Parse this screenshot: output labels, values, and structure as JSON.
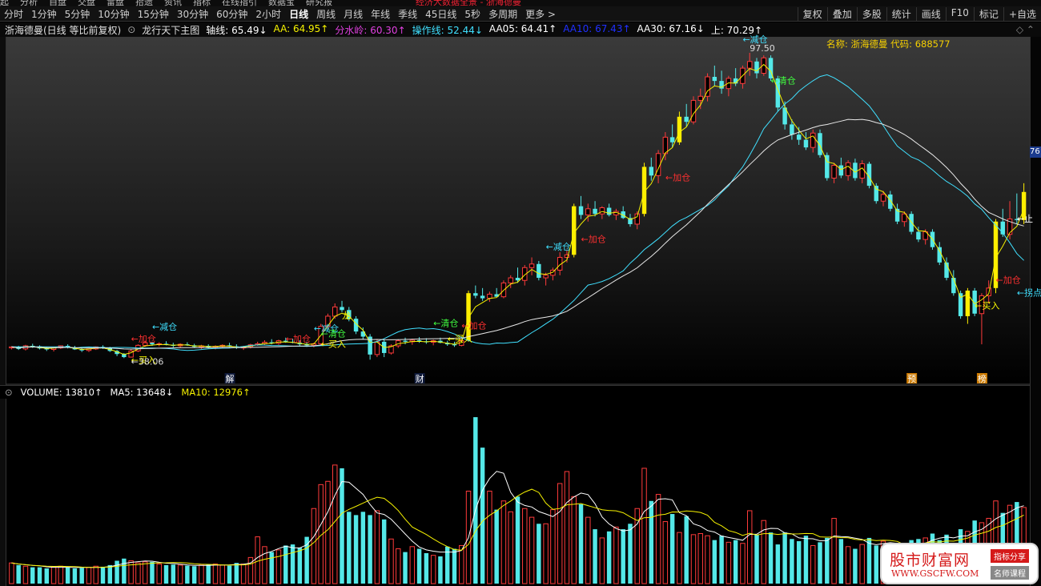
{
  "top_fragments": [
    "起",
    "分析",
    "自盘",
    "交盘",
    "雷盘",
    "拾遗",
    "资讯",
    "指标",
    "在线指引",
    "数据宝",
    "研究报"
  ],
  "top_red_text": "经济大数据全景 - 浙海德曼",
  "periods": [
    "分时",
    "1分钟",
    "5分钟",
    "10分钟",
    "15分钟",
    "30分钟",
    "60分钟",
    "2小时",
    "日线",
    "周线",
    "月线",
    "年线",
    "季线",
    "45日线",
    "5秒",
    "多周期",
    "更多 >"
  ],
  "active_period": "日线",
  "right_tools": [
    "复权",
    "叠加",
    "多股",
    "统计",
    "画线",
    "F10",
    "标记",
    "+自选"
  ],
  "stock_title": "浙海德曼(日线 等比前复权)",
  "indicator_name": "龙行天下主图",
  "indicator_values": [
    {
      "text": "轴线: 65.49↓",
      "color": "#ffffff"
    },
    {
      "text": "AA: 64.95↑",
      "color": "#f6f200"
    },
    {
      "text": "分水岭: 60.30↑",
      "color": "#e040e0"
    },
    {
      "text": "操作线: 52.44↓",
      "color": "#40e0ff"
    },
    {
      "text": "AA05: 64.41↑",
      "color": "#ffffff"
    },
    {
      "text": "AA10: 67.43↑",
      "color": "#2030ff"
    },
    {
      "text": "AA30: 67.16↓",
      "color": "#ffffff"
    },
    {
      "text": "上: 70.29↑",
      "color": "#ffffff"
    }
  ],
  "name_label": "名称: 浙海德曼 代码: 688577",
  "right_axis_tag": "76",
  "volume_values": [
    {
      "text": "VOLUME: 13810↑",
      "color": "#ffffff"
    },
    {
      "text": "MA5: 13648↓",
      "color": "#ffffff"
    },
    {
      "text": "MA10: 12976↑",
      "color": "#f6f200"
    }
  ],
  "watermark": {
    "title": "股市财富网",
    "url": "WWW.GSCFW.COM",
    "tag1": "指标分享",
    "tag2": "名师课程"
  },
  "chart_data": {
    "type": "candlestick",
    "stock": "浙海德曼",
    "code": "688577",
    "ohlc": [
      [
        39.8,
        40.1,
        39.5,
        40.0
      ],
      [
        40.0,
        40.2,
        39.4,
        39.6
      ],
      [
        39.6,
        40.4,
        39.3,
        40.2
      ],
      [
        40.2,
        40.6,
        39.8,
        40.1
      ],
      [
        40.1,
        40.3,
        39.5,
        39.7
      ],
      [
        39.7,
        40.0,
        39.2,
        39.5
      ],
      [
        39.5,
        39.9,
        39.1,
        39.8
      ],
      [
        39.8,
        40.3,
        39.6,
        40.2
      ],
      [
        40.2,
        40.5,
        39.7,
        39.9
      ],
      [
        39.9,
        40.2,
        39.4,
        39.5
      ],
      [
        39.5,
        39.8,
        39.0,
        39.3
      ],
      [
        39.3,
        39.7,
        39.0,
        39.6
      ],
      [
        39.6,
        40.1,
        39.4,
        40.0
      ],
      [
        40.0,
        40.3,
        39.6,
        39.8
      ],
      [
        39.8,
        40.0,
        39.0,
        39.2
      ],
      [
        39.2,
        39.4,
        38.2,
        38.6
      ],
      [
        38.6,
        38.8,
        37.8,
        38.0
      ],
      [
        38.0,
        39.5,
        38.06,
        39.2
      ],
      [
        39.2,
        40.5,
        39.0,
        40.3
      ],
      [
        40.3,
        41.2,
        40.0,
        40.8
      ],
      [
        40.8,
        41.0,
        40.2,
        40.5
      ],
      [
        40.5,
        40.9,
        40.1,
        40.6
      ],
      [
        40.6,
        41.1,
        40.3,
        40.4
      ],
      [
        40.4,
        40.8,
        39.9,
        40.2
      ],
      [
        40.2,
        40.7,
        39.8,
        40.5
      ],
      [
        40.5,
        40.9,
        40.2,
        40.3
      ],
      [
        40.3,
        40.6,
        39.8,
        40.0
      ],
      [
        40.0,
        40.4,
        39.6,
        40.2
      ],
      [
        40.2,
        40.5,
        39.7,
        39.9
      ],
      [
        39.9,
        40.3,
        39.5,
        40.1
      ],
      [
        40.1,
        40.5,
        39.8,
        40.3
      ],
      [
        40.3,
        40.8,
        40.0,
        40.1
      ],
      [
        40.1,
        40.5,
        39.6,
        39.8
      ],
      [
        39.8,
        40.2,
        39.4,
        40.0
      ],
      [
        40.0,
        40.6,
        39.7,
        40.4
      ],
      [
        40.4,
        41.0,
        40.2,
        40.6
      ],
      [
        40.6,
        41.3,
        40.3,
        40.9
      ],
      [
        40.9,
        41.5,
        40.5,
        40.7
      ],
      [
        40.7,
        41.4,
        40.4,
        41.2
      ],
      [
        41.2,
        41.8,
        40.8,
        41.0
      ],
      [
        41.0,
        41.6,
        40.7,
        40.8
      ],
      [
        40.8,
        41.3,
        40.2,
        40.5
      ],
      [
        40.5,
        41.0,
        40.0,
        40.3
      ],
      [
        40.3,
        40.8,
        39.9,
        40.6
      ],
      [
        40.6,
        44.5,
        40.4,
        44.0
      ],
      [
        44.0,
        46.5,
        43.5,
        46.0
      ],
      [
        46.0,
        48.5,
        45.5,
        47.8
      ],
      [
        47.8,
        49.0,
        46.8,
        47.2
      ],
      [
        47.2,
        47.8,
        45.0,
        45.5
      ],
      [
        45.5,
        46.0,
        42.5,
        43.0
      ],
      [
        43.0,
        43.8,
        41.5,
        42.0
      ],
      [
        42.0,
        42.5,
        37.5,
        38.5
      ],
      [
        38.5,
        41.5,
        38.0,
        41.0
      ],
      [
        41.0,
        41.5,
        38.0,
        38.8
      ],
      [
        38.8,
        40.5,
        38.5,
        40.2
      ],
      [
        40.2,
        41.5,
        39.8,
        41.2
      ],
      [
        41.2,
        41.8,
        40.5,
        41.0
      ],
      [
        41.0,
        41.6,
        40.4,
        41.3
      ],
      [
        41.3,
        41.9,
        40.8,
        41.1
      ],
      [
        41.1,
        41.7,
        40.6,
        40.9
      ],
      [
        40.9,
        41.4,
        40.3,
        41.2
      ],
      [
        41.2,
        41.8,
        40.7,
        40.8
      ],
      [
        40.8,
        41.2,
        40.2,
        40.5
      ],
      [
        40.5,
        41.0,
        40.0,
        40.3
      ],
      [
        40.3,
        41.5,
        40.1,
        41.2
      ],
      [
        41.2,
        51.0,
        41.0,
        50.5
      ],
      [
        50.5,
        52.0,
        49.5,
        50.0
      ],
      [
        50.0,
        51.5,
        49.0,
        49.5
      ],
      [
        49.5,
        50.8,
        48.8,
        50.3
      ],
      [
        50.3,
        51.5,
        49.8,
        49.8
      ],
      [
        49.8,
        53.0,
        49.5,
        52.5
      ],
      [
        52.5,
        54.0,
        51.5,
        53.5
      ],
      [
        53.5,
        55.5,
        52.5,
        53.0
      ],
      [
        53.0,
        56.0,
        52.0,
        55.5
      ],
      [
        55.5,
        57.5,
        54.0,
        56.2
      ],
      [
        56.2,
        56.8,
        53.0,
        53.5
      ],
      [
        53.5,
        54.5,
        52.0,
        54.0
      ],
      [
        54.0,
        55.5,
        53.0,
        55.0
      ],
      [
        55.0,
        58.5,
        54.0,
        57.5
      ],
      [
        57.5,
        59.0,
        56.5,
        58.0
      ],
      [
        58.0,
        68.0,
        57.5,
        67.5
      ],
      [
        67.5,
        69.5,
        65.0,
        65.8
      ],
      [
        65.8,
        68.0,
        64.5,
        67.0
      ],
      [
        67.0,
        68.5,
        65.5,
        66.0
      ],
      [
        66.0,
        67.5,
        65.0,
        67.2
      ],
      [
        67.2,
        68.0,
        65.5,
        65.8
      ],
      [
        65.8,
        67.0,
        64.8,
        66.5
      ],
      [
        66.5,
        67.5,
        65.0,
        65.2
      ],
      [
        65.2,
        66.0,
        63.5,
        64.0
      ],
      [
        64.0,
        66.5,
        63.0,
        66.0
      ],
      [
        66.0,
        76.0,
        65.5,
        75.2
      ],
      [
        75.2,
        77.0,
        72.5,
        73.5
      ],
      [
        73.5,
        78.5,
        72.0,
        77.8
      ],
      [
        77.8,
        82.0,
        76.5,
        81.0
      ],
      [
        81.0,
        83.5,
        79.0,
        80.0
      ],
      [
        80.0,
        86.0,
        79.5,
        85.0
      ],
      [
        85.0,
        87.5,
        83.0,
        84.0
      ],
      [
        84.0,
        89.0,
        83.5,
        88.2
      ],
      [
        88.2,
        90.5,
        86.5,
        89.0
      ],
      [
        89.0,
        93.5,
        88.0,
        92.8
      ],
      [
        92.8,
        95.0,
        91.0,
        92.0
      ],
      [
        92.0,
        94.0,
        89.5,
        90.5
      ],
      [
        90.5,
        93.0,
        89.0,
        92.5
      ],
      [
        92.5,
        94.5,
        91.0,
        91.5
      ],
      [
        91.5,
        95.0,
        90.5,
        94.5
      ],
      [
        94.5,
        97.5,
        93.0,
        95.8
      ],
      [
        95.8,
        96.5,
        92.5,
        93.5
      ],
      [
        93.5,
        97.0,
        93.0,
        96.5
      ],
      [
        96.5,
        97.0,
        92.0,
        92.5
      ],
      [
        92.5,
        93.0,
        86.0,
        86.8
      ],
      [
        86.8,
        88.0,
        82.5,
        83.5
      ],
      [
        83.5,
        84.5,
        80.5,
        81.5
      ],
      [
        81.5,
        83.0,
        79.5,
        80.5
      ],
      [
        80.5,
        82.0,
        78.5,
        79.0
      ],
      [
        79.0,
        82.5,
        78.0,
        81.8
      ],
      [
        81.8,
        82.5,
        77.0,
        77.5
      ],
      [
        77.5,
        78.0,
        72.5,
        73.0
      ],
      [
        73.0,
        76.0,
        72.0,
        75.5
      ],
      [
        75.5,
        77.0,
        73.0,
        73.5
      ],
      [
        73.5,
        76.5,
        72.5,
        76.0
      ],
      [
        76.0,
        76.8,
        72.5,
        73.0
      ],
      [
        73.0,
        76.5,
        72.0,
        75.8
      ],
      [
        75.8,
        76.2,
        71.0,
        71.5
      ],
      [
        71.5,
        72.0,
        68.0,
        68.5
      ],
      [
        68.5,
        70.5,
        67.5,
        69.8
      ],
      [
        69.8,
        70.5,
        66.5,
        67.0
      ],
      [
        67.0,
        68.0,
        64.0,
        64.5
      ],
      [
        64.5,
        66.5,
        63.5,
        66.0
      ],
      [
        66.0,
        66.5,
        62.0,
        62.5
      ],
      [
        62.5,
        63.5,
        60.5,
        61.0
      ],
      [
        61.0,
        63.0,
        60.0,
        62.5
      ],
      [
        62.5,
        63.0,
        59.0,
        59.5
      ],
      [
        59.5,
        60.5,
        56.0,
        56.5
      ],
      [
        56.5,
        57.5,
        53.0,
        53.5
      ],
      [
        53.5,
        55.0,
        50.0,
        50.5
      ],
      [
        50.5,
        51.0,
        45.5,
        46.0
      ],
      [
        46.0,
        51.5,
        44.5,
        51.0
      ],
      [
        51.0,
        51.5,
        46.0,
        46.5
      ],
      [
        46.5,
        50.5,
        40.5,
        50.0
      ],
      [
        50.0,
        53.0,
        48.5,
        51.5
      ],
      [
        51.5,
        65.0,
        50.5,
        64.5
      ],
      [
        64.5,
        67.0,
        61.5,
        62.0
      ],
      [
        62.0,
        68.5,
        61.0,
        65.0
      ],
      [
        65.0,
        70.0,
        64.0,
        64.8
      ],
      [
        64.8,
        72.0,
        64.0,
        70.29
      ]
    ],
    "volume": [
      1900,
      1700,
      1600,
      1500,
      1500,
      1400,
      1500,
      1600,
      1500,
      1400,
      1450,
      1500,
      1600,
      1550,
      1700,
      2100,
      2300,
      2100,
      1900,
      2000,
      2000,
      1800,
      1700,
      1750,
      1700,
      1650,
      1600,
      1700,
      1750,
      1800,
      1700,
      1650,
      1900,
      1800,
      2400,
      4300,
      3400,
      2900,
      3100,
      3500,
      3600,
      3300,
      4300,
      6900,
      9100,
      9400,
      10900,
      10600,
      6600,
      6300,
      6600,
      6300,
      6700,
      5900,
      4100,
      3200,
      2900,
      3400,
      3200,
      2800,
      2600,
      2500,
      3400,
      3200,
      3500,
      8500,
      15300,
      12500,
      8500,
      6800,
      7600,
      6600,
      8000,
      6900,
      6100,
      5500,
      5500,
      6800,
      9200,
      10300,
      8000,
      7300,
      6100,
      5000,
      4200,
      4800,
      5200,
      5000,
      5500,
      6900,
      10600,
      7600,
      8200,
      5700,
      6400,
      4700,
      6200,
      4500,
      4600,
      4400,
      4000,
      4400,
      3800,
      4000,
      3700,
      6700,
      4500,
      5800,
      4700,
      3600,
      4700,
      4100,
      3900,
      4400,
      3500,
      3800,
      4200,
      6000,
      4100,
      3400,
      3200,
      3600,
      4200,
      3500,
      3900,
      3600,
      3300,
      3000,
      4000,
      4100,
      4200,
      4600,
      4000,
      4500,
      3700,
      5000,
      4800,
      5800,
      5600,
      6000,
      7600,
      6500,
      7200,
      7500,
      7000
    ],
    "ylim": [
      33,
      100
    ],
    "vol_ylim": [
      0,
      17000
    ],
    "price_marks": [
      {
        "text": "←38.06",
        "x": 17,
        "y": 38.06
      },
      {
        "text": "97.50",
        "x": 105,
        "y": 97.5
      }
    ],
    "annotations": [
      {
        "text": "←买入",
        "color": "#ffff00",
        "x": 17,
        "y": 36.8
      },
      {
        "text": "←减仓",
        "color": "#40e0ff",
        "x": 20,
        "y": 43.3
      },
      {
        "text": "←加仓",
        "color": "#ff3030",
        "x": 17,
        "y": 41.0
      },
      {
        "text": "←减仓",
        "color": "#40e0ff",
        "x": 43,
        "y": 43.0
      },
      {
        "text": "←加仓",
        "color": "#ff3030",
        "x": 39,
        "y": 41.0
      },
      {
        "text": "←清仓",
        "color": "#40ff40",
        "x": 44,
        "y": 42.0
      },
      {
        "text": "←买入",
        "color": "#ffff00",
        "x": 44,
        "y": 40.0
      },
      {
        "text": "龙",
        "color": "#ffff00",
        "x": 47,
        "y": 45.5
      },
      {
        "text": "←清仓",
        "color": "#40ff40",
        "x": 60,
        "y": 44.0
      },
      {
        "text": "←加仓",
        "color": "#ff3030",
        "x": 64,
        "y": 43.6
      },
      {
        "text": "←买入",
        "color": "#ffff00",
        "x": 62,
        "y": 41.0
      },
      {
        "text": "←减仓",
        "color": "#40e0ff",
        "x": 76,
        "y": 59.0
      },
      {
        "text": "←加仓",
        "color": "#ff3030",
        "x": 81,
        "y": 60.5
      },
      {
        "text": "←加仓",
        "color": "#ff3030",
        "x": 93,
        "y": 72.5
      },
      {
        "text": "←减仓",
        "color": "#40e0ff",
        "x": 104,
        "y": 99.5
      },
      {
        "text": "←清仓",
        "color": "#40ff40",
        "x": 108,
        "y": 91.5
      },
      {
        "text": "←买入",
        "color": "#ffff00",
        "x": 137,
        "y": 47.5
      },
      {
        "text": "←加仓",
        "color": "#ff3030",
        "x": 140,
        "y": 52.5
      },
      {
        "text": "←拐点",
        "color": "#40e0ff",
        "x": 143,
        "y": 50.0
      },
      {
        "text": "←止",
        "color": "#ffffff",
        "x": 143,
        "y": 64.5
      }
    ],
    "markers": [
      {
        "text": "解",
        "x": 31
      },
      {
        "text": "财",
        "x": 58
      },
      {
        "text": "预",
        "x": 128
      },
      {
        "text": "榜",
        "x": 138
      }
    ],
    "lines": [
      {
        "name": "AA",
        "color": "#f6f200",
        "type": "ema",
        "period": 3
      },
      {
        "name": "AA10",
        "color": "#40e0ff",
        "type": "shift_ma",
        "period": 10,
        "shift": 8
      },
      {
        "name": "AA30",
        "color": "#e8e8e8",
        "type": "ma",
        "period": 30
      }
    ]
  }
}
